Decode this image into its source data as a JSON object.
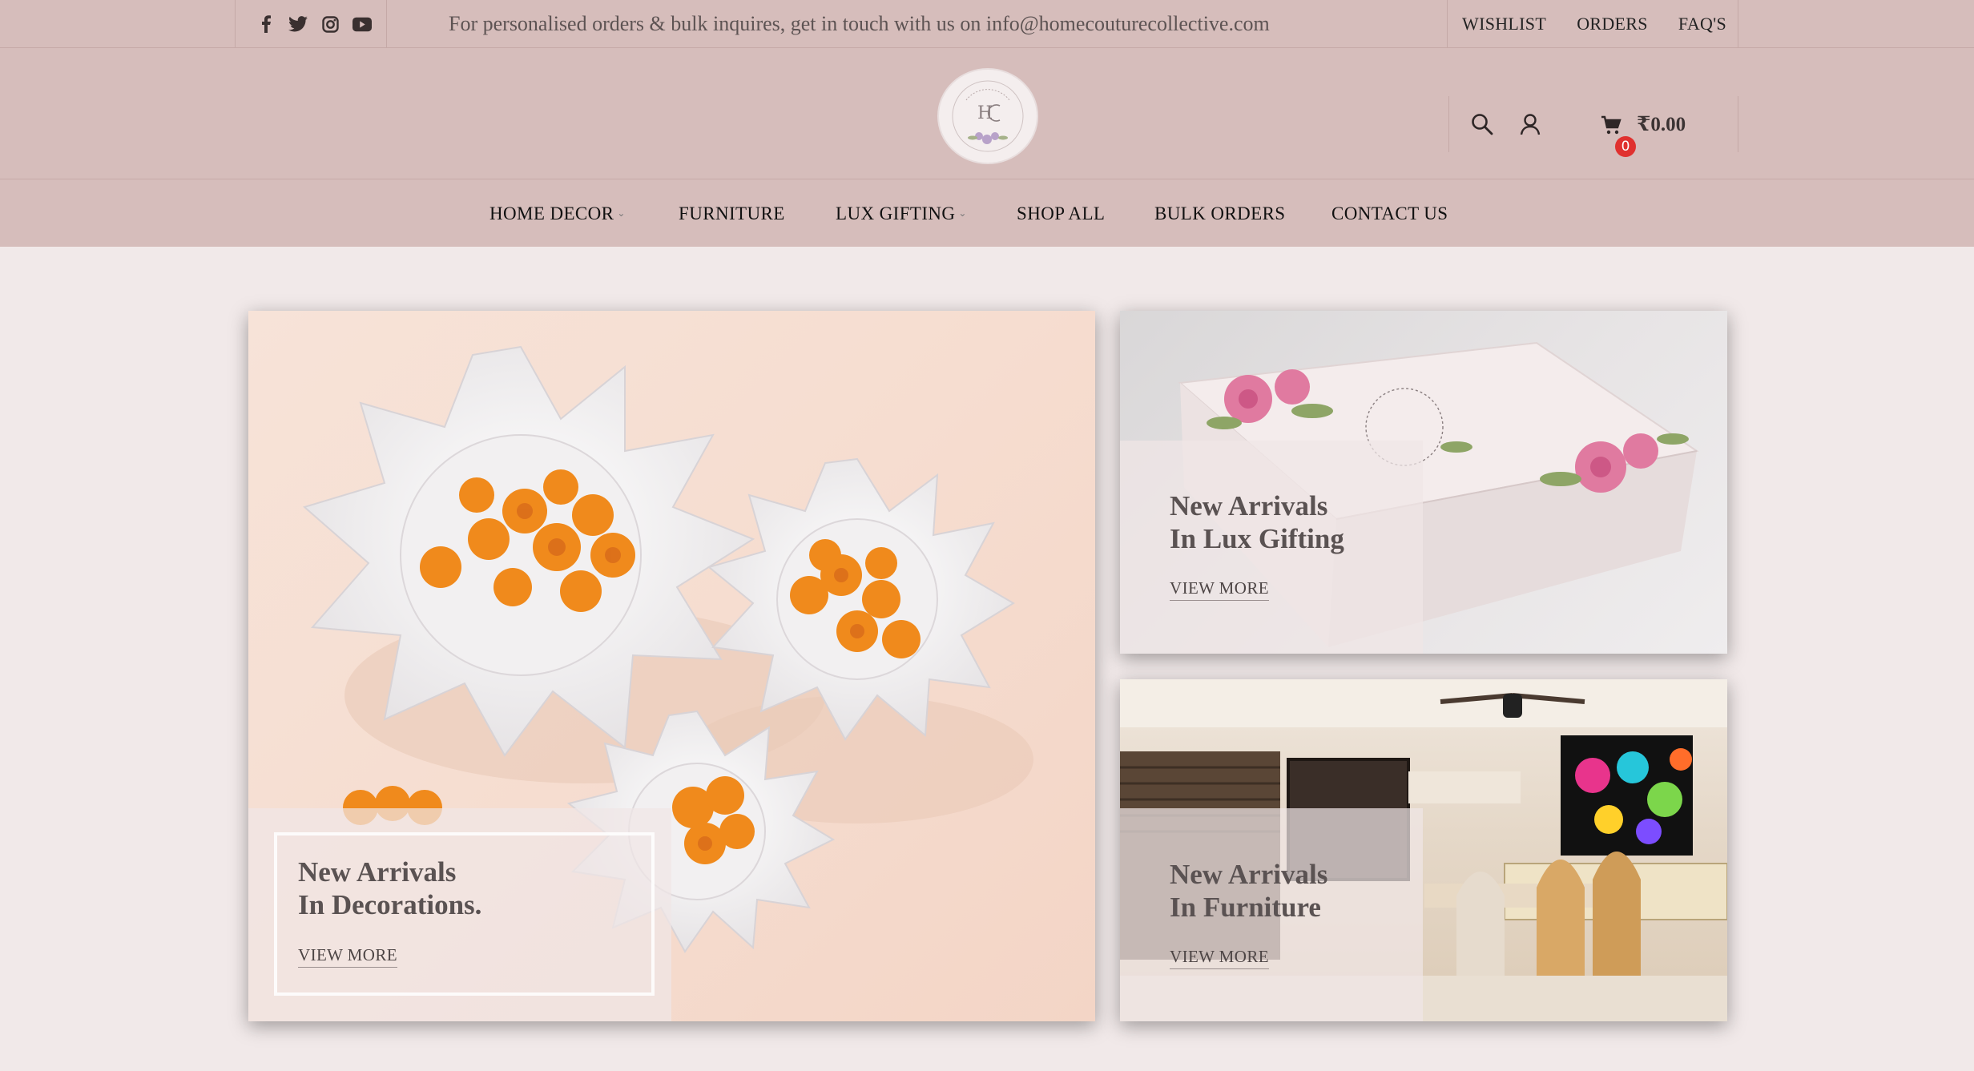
{
  "topbar": {
    "message": "For personalised orders & bulk inquires, get in touch with us on info@homecouturecollective.com",
    "social_icons": [
      "facebook-icon",
      "twitter-icon",
      "instagram-icon",
      "youtube-icon"
    ],
    "links": [
      "WISHLIST",
      "ORDERS",
      "FAQ'S"
    ]
  },
  "header": {
    "cart_count": "0",
    "cart_total": "₹0.00"
  },
  "nav": {
    "items": [
      {
        "label": "HOME DECOR",
        "has_dropdown": true
      },
      {
        "label": "FURNITURE",
        "has_dropdown": false
      },
      {
        "label": "LUX GIFTING",
        "has_dropdown": true
      },
      {
        "label": "SHOP ALL",
        "has_dropdown": false
      },
      {
        "label": "BULK ORDERS",
        "has_dropdown": false
      },
      {
        "label": "CONTACT US",
        "has_dropdown": false
      }
    ]
  },
  "banners": [
    {
      "title": "New Arrivals\nIn Decorations.",
      "cta": "VIEW MORE"
    },
    {
      "title": "New Arrivals\nIn Lux Gifting",
      "cta": "VIEW MORE"
    },
    {
      "title": "New Arrivals\nIn Furniture",
      "cta": "VIEW MORE"
    }
  ],
  "colors": {
    "bar": "#d6bdbb",
    "page": "#f1e9e9",
    "badge": "#e0312f"
  }
}
